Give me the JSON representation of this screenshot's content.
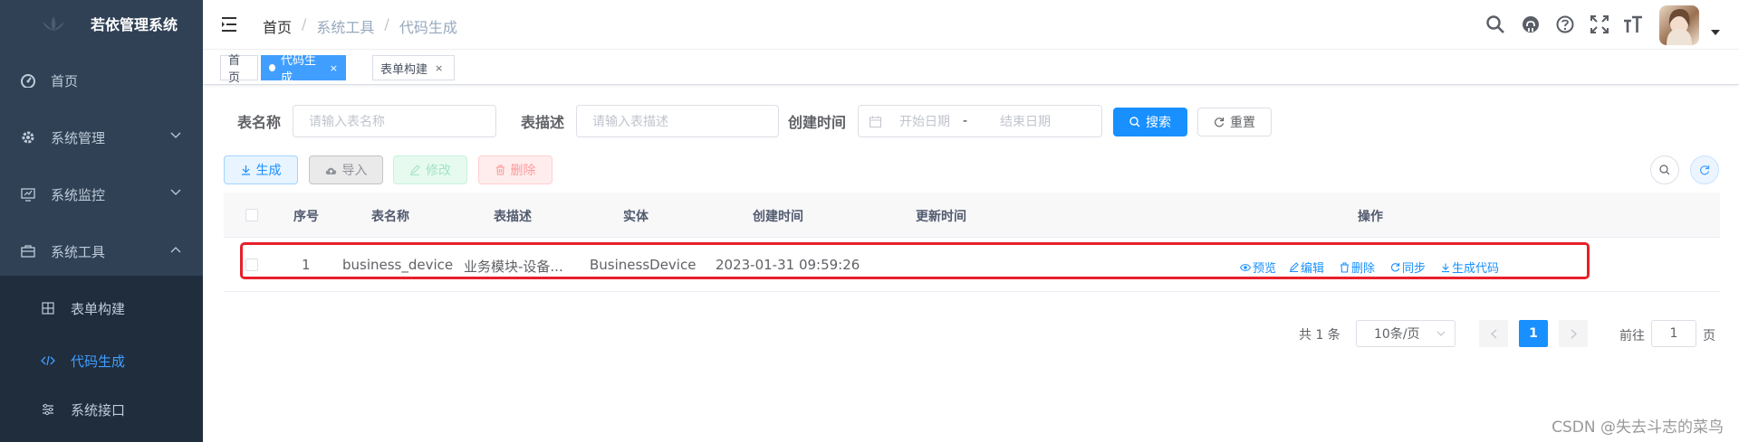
{
  "app": {
    "title": "若依管理系统"
  },
  "sidebar": {
    "items": [
      {
        "label": "首页",
        "icon": "dashboard-icon"
      },
      {
        "label": "系统管理",
        "icon": "gear-icon"
      },
      {
        "label": "系统监控",
        "icon": "monitor-icon"
      },
      {
        "label": "系统工具",
        "icon": "toolbox-icon"
      }
    ],
    "subitems": [
      {
        "label": "表单构建",
        "icon": "grid-icon"
      },
      {
        "label": "代码生成",
        "icon": "code-icon"
      },
      {
        "label": "系统接口",
        "icon": "sliders-icon"
      }
    ]
  },
  "breadcrumb": [
    "首页",
    "系统工具",
    "代码生成"
  ],
  "tags": [
    {
      "label": "首页"
    },
    {
      "label": "代码生成",
      "close": "×"
    },
    {
      "label": "表单构建",
      "close": "×"
    }
  ],
  "search": {
    "table_name_label": "表名称",
    "table_name_placeholder": "请输入表名称",
    "table_desc_label": "表描述",
    "table_desc_placeholder": "请输入表描述",
    "create_time_label": "创建时间",
    "start_placeholder": "开始日期",
    "range_separator": "-",
    "end_placeholder": "结束日期",
    "search_button": "搜索",
    "reset_button": "重置"
  },
  "toolbar": {
    "generate": "生成",
    "import": "导入",
    "edit": "修改",
    "delete": "删除"
  },
  "table": {
    "columns": [
      "序号",
      "表名称",
      "表描述",
      "实体",
      "创建时间",
      "更新时间",
      "操作"
    ],
    "rows": [
      {
        "index": "1",
        "table_name": "business_device",
        "table_desc": "业务模块-设备...",
        "entity": "BusinessDevice",
        "create_time": "2023-01-31 09:59:26",
        "update_time": "",
        "actions": [
          "预览",
          "编辑",
          "删除",
          "同步",
          "生成代码"
        ]
      }
    ]
  },
  "pagination": {
    "total_text": "共 1 条",
    "page_size": "10条/页",
    "current_page": "1",
    "goto_prefix": "前往",
    "goto_value": "1",
    "goto_suffix": "页"
  },
  "watermark": "CSDN @失去斗志的菜鸟",
  "colors": {
    "sidebar_bg": "#304156",
    "submenu_bg": "#1f2d3d",
    "primary": "#1890ff",
    "highlight": "#e8202a"
  }
}
